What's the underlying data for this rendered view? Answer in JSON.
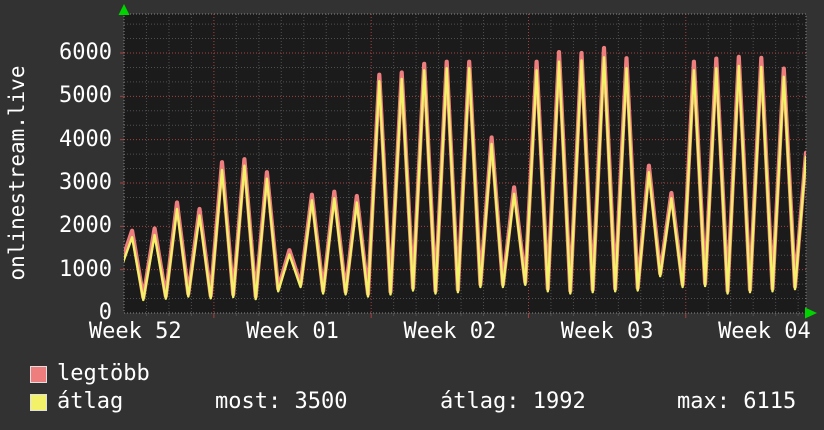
{
  "page": {
    "background": "#323232",
    "plot_background": "#1b1b1b",
    "text_color": "#ffffff"
  },
  "y_axis": {
    "title": "onlinestream.live"
  },
  "footer": {
    "separator": ": ",
    "stats": [
      {
        "label": "most",
        "value": "3500"
      },
      {
        "label": "átlag",
        "value": "1992"
      },
      {
        "label": "max",
        "value": "6115"
      }
    ]
  },
  "chart_data": {
    "type": "line",
    "y_axis": {
      "tick_values": [
        0,
        1000,
        2000,
        3000,
        4000,
        5000,
        6000
      ],
      "ylim": [
        0,
        6900
      ],
      "minor_divisions_per_major": 3
    },
    "x_axis": {
      "tick_labels": [
        "Week 52",
        "Week 01",
        "Week 02",
        "Week 03",
        "Week 04"
      ],
      "tick_center_days": [
        0.5,
        7.5,
        14.5,
        21.5,
        28.5
      ],
      "week_boundary_days": [
        4,
        11,
        18,
        25
      ],
      "total_days": 30.35,
      "day_minor_grid": true
    },
    "legend": [
      {
        "label": "legtöbb",
        "color": "#ee7e7e"
      },
      {
        "label": "átlag",
        "color": "#f3f167"
      }
    ],
    "stats": {
      "most": 3500,
      "atlag": 1992,
      "max": 6115
    },
    "peak_day_offset": 0.36,
    "trough_day_offset": 0.86,
    "troughs_after_peak": [
      300,
      330,
      380,
      340,
      370,
      320,
      500,
      600,
      450,
      430,
      380,
      430,
      520,
      450,
      480,
      600,
      600,
      650,
      500,
      450,
      480,
      500,
      520,
      850,
      600,
      620,
      450,
      480,
      500,
      550
    ],
    "series": [
      {
        "name": "legtöbb",
        "color": "#ee7e7e",
        "stroke_width": 4.2,
        "trough_offset": 60,
        "edge_end": 3700,
        "peaks": [
          1900,
          1950,
          2550,
          2400,
          3480,
          3550,
          3250,
          1450,
          2730,
          2800,
          2700,
          5500,
          5550,
          5750,
          5800,
          5800,
          4050,
          2900,
          5800,
          6020,
          6000,
          6115,
          5880,
          3400,
          2770,
          5800,
          5870,
          5910,
          5890,
          5640
        ]
      },
      {
        "name": "átlag",
        "color": "#f3f167",
        "stroke_width": 2.4,
        "trough_offset": 0,
        "edge_end": 3600,
        "peaks": [
          1750,
          1800,
          2400,
          2250,
          3300,
          3400,
          3100,
          1350,
          2600,
          2650,
          2550,
          5350,
          5400,
          5600,
          5650,
          5650,
          3900,
          2750,
          5600,
          5800,
          5830,
          5900,
          5650,
          3250,
          2650,
          5600,
          5650,
          5700,
          5680,
          5450
        ]
      }
    ],
    "grid": {
      "minor_color": "#4f4f4f",
      "major_color": "#a84040",
      "border_color": "#888888",
      "arrow_color": "#00d400"
    }
  }
}
